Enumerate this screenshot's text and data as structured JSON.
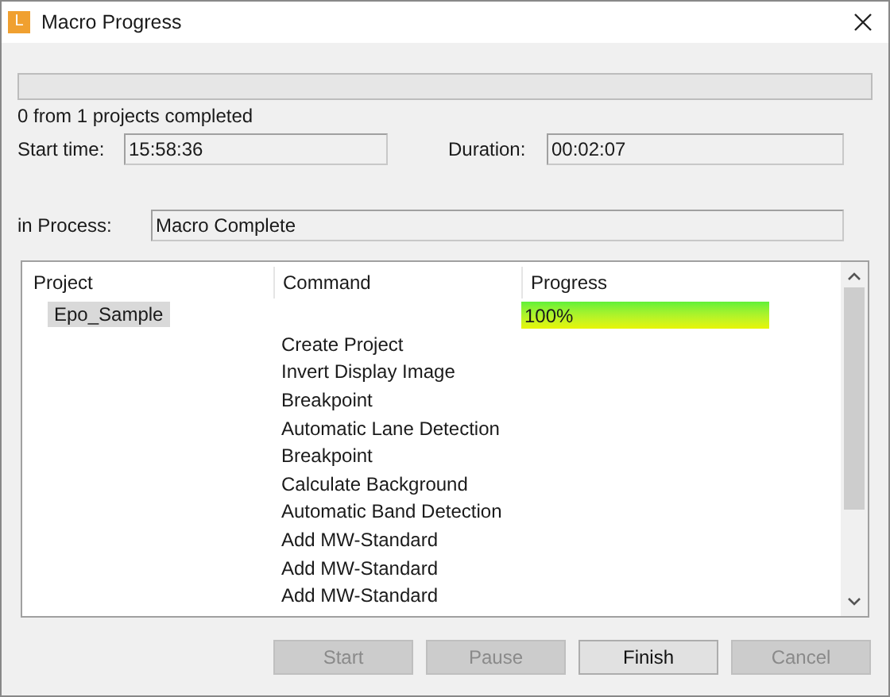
{
  "window": {
    "title": "Macro Progress",
    "app_icon_letter": "L"
  },
  "overall_progress": {
    "level": 0
  },
  "summary": "0 from 1 projects completed",
  "start_time": {
    "label": "Start time:",
    "value": "15:58:36"
  },
  "duration": {
    "label": "Duration:",
    "value": "00:02:07"
  },
  "in_process": {
    "label": "in Process:",
    "value": "Macro Complete"
  },
  "table": {
    "columns": [
      "Project",
      "Command",
      "Progress"
    ],
    "projects": [
      {
        "name": "Epo_Sample",
        "selected": true,
        "progress": {
          "text": "100%",
          "level": 1
        },
        "commands": [
          "Create Project",
          "Invert Display Image",
          "Breakpoint",
          "Automatic Lane Detection",
          "Breakpoint",
          "Calculate Background",
          "Automatic Band Detection",
          "Add MW-Standard",
          "Add MW-Standard",
          "Add MW-Standard"
        ]
      }
    ]
  },
  "buttons": [
    {
      "label": "Start",
      "disabled": true
    },
    {
      "label": "Pause",
      "disabled": true
    },
    {
      "label": "Finish",
      "disabled": false
    },
    {
      "label": "Cancel",
      "disabled": true
    }
  ]
}
